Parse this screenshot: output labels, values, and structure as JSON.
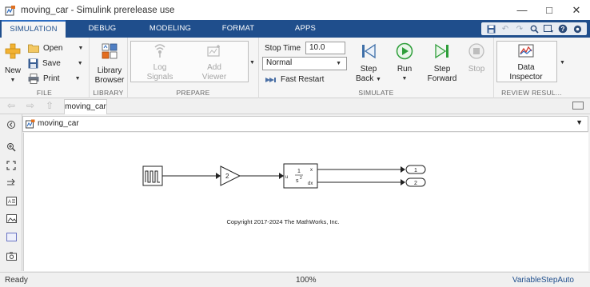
{
  "window": {
    "title": "moving_car - Simulink prerelease use",
    "controls": [
      "minimize-icon",
      "maximize-icon",
      "close-icon"
    ]
  },
  "tabs": [
    {
      "label": "SIMULATION",
      "active": true
    },
    {
      "label": "DEBUG",
      "active": false
    },
    {
      "label": "MODELING",
      "active": false
    },
    {
      "label": "FORMAT",
      "active": false
    },
    {
      "label": "APPS",
      "active": false
    }
  ],
  "quick_access": [
    "save-icon",
    "undo-icon",
    "redo-icon",
    "search-icon",
    "layout-icon",
    "help-icon",
    "collapse-icon"
  ],
  "ribbon": {
    "file": {
      "label": "FILE",
      "new": "New",
      "open": "Open",
      "save": "Save",
      "print": "Print"
    },
    "library": {
      "label": "LIBRARY",
      "browser_line1": "Library",
      "browser_line2": "Browser"
    },
    "prepare": {
      "label": "PREPARE",
      "log_line1": "Log",
      "log_line2": "Signals",
      "add_line1": "Add",
      "add_line2": "Viewer"
    },
    "simulate": {
      "label": "SIMULATE",
      "stop_time_label": "Stop Time",
      "stop_time_value": "10.0",
      "mode": "Normal",
      "fast_restart": "Fast Restart",
      "step_back_line1": "Step",
      "step_back_line2": "Back",
      "run": "Run",
      "step_forward_line1": "Step",
      "step_forward_line2": "Forward",
      "stop": "Stop"
    },
    "review": {
      "label": "REVIEW RESUL...",
      "inspector_line1": "Data",
      "inspector_line2": "Inspector"
    }
  },
  "document_tab": "moving_car",
  "breadcrumb": "moving_car",
  "model": {
    "gain_value": "2",
    "integrator_input": "u",
    "integrator_numerator": "1",
    "integrator_denominator": "s",
    "integrator_exponent": "2",
    "integrator_out_x": "x",
    "integrator_out_dx": "dx",
    "outport_1": "1",
    "outport_2": "2",
    "copyright": "Copyright 2017-2024 The MathWorks, Inc."
  },
  "status": {
    "state": "Ready",
    "zoom": "100%",
    "solver": "VariableStepAuto"
  },
  "colors": {
    "tab_strip": "#1f4e8c",
    "run_green": "#2e9e3a",
    "accent_blue": "#2d6cc0"
  }
}
